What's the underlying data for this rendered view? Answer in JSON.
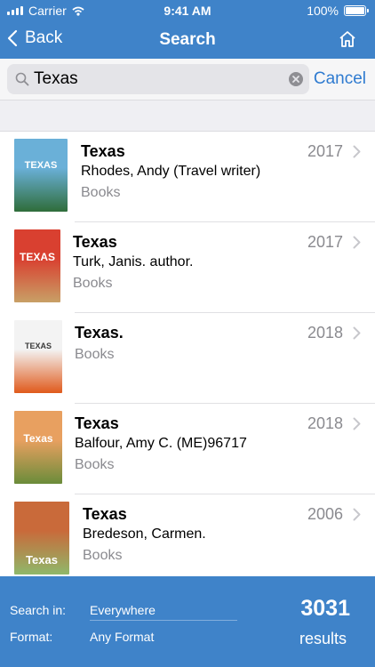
{
  "status_bar": {
    "carrier": "Carrier",
    "time": "9:41 AM",
    "battery_percent": "100%",
    "battery_level": 1.0
  },
  "nav": {
    "back_label": "Back",
    "title": "Search"
  },
  "search": {
    "query": "Texas",
    "cancel_label": "Cancel"
  },
  "results": [
    {
      "title": "Texas",
      "author": "Rhodes, Andy (Travel writer)",
      "format": "Books",
      "year": "2017",
      "cover": {
        "label": "TEXAS",
        "top": "#6ab0d8",
        "bottom": "#2f6d3a"
      }
    },
    {
      "title": "Texas",
      "author": "Turk, Janis. author.",
      "format": "Books",
      "year": "2017",
      "cover": {
        "label": "TEXAS",
        "top": "#d94030",
        "bottom": "#c8a066"
      }
    },
    {
      "title": "Texas.",
      "author": "",
      "format": "Books",
      "year": "2018",
      "cover": {
        "label": "TEXAS",
        "top": "#f3f3f3",
        "bottom": "#e05a1c"
      }
    },
    {
      "title": "Texas",
      "author": "Balfour, Amy C. (ME)96717",
      "format": "Books",
      "year": "2018",
      "cover": {
        "label": "Texas",
        "top": "#e8a060",
        "bottom": "#6a8c3a"
      }
    },
    {
      "title": "Texas",
      "author": "Bredeson, Carmen.",
      "format": "Books",
      "year": "2006",
      "cover": {
        "label": "Texas",
        "top": "#c96a3a",
        "bottom": "#8fb86a"
      }
    }
  ],
  "footer": {
    "search_in_label": "Search in:",
    "search_in_value": "Everywhere",
    "format_label": "Format:",
    "format_value": "Any Format",
    "count": "3031",
    "count_label": "results"
  },
  "colors": {
    "accent": "#3f83c9",
    "link": "#2f7bd0",
    "muted": "#8a8a8f"
  },
  "icons": [
    "signal-icon",
    "wifi-icon",
    "battery-icon",
    "back-chevron-icon",
    "home-icon",
    "search-icon",
    "clear-icon",
    "chevron-right-icon"
  ]
}
